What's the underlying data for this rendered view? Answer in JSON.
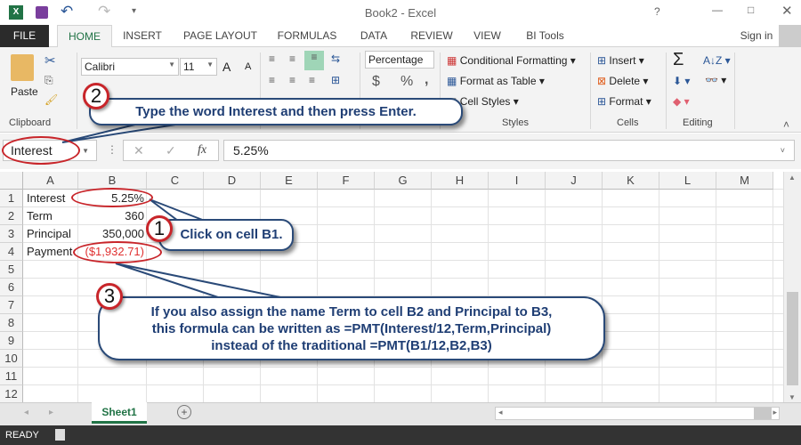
{
  "title": "Book2 - Excel",
  "qat": {
    "excel": "excel-logo",
    "save": "save-icon",
    "undo": "undo-icon",
    "redo": "redo-icon"
  },
  "tabs": [
    "FILE",
    "HOME",
    "INSERT",
    "PAGE LAYOUT",
    "FORMULAS",
    "DATA",
    "REVIEW",
    "VIEW",
    "BI Tools"
  ],
  "active_tab": "HOME",
  "sign_in": "Sign in",
  "ribbon": {
    "paste": "Paste",
    "clipboard": "Clipboard",
    "font": "Calibri",
    "size": "11",
    "number_format": "Percentage",
    "dollar": "$",
    "percent": "%",
    "comma": ",",
    "conditional": "Conditional Formatting",
    "format_table": "Format as Table",
    "cell_styles": "Cell Styles",
    "styles": "Styles",
    "insert": "Insert",
    "delete": "Delete",
    "format": "Format",
    "cells": "Cells",
    "sigma": "Σ",
    "editing": "Editing"
  },
  "formula_bar": {
    "name_box": "Interest",
    "fx": "fx",
    "value": "5.25%"
  },
  "columns": [
    "A",
    "B",
    "C",
    "D",
    "E",
    "F",
    "G",
    "H",
    "I",
    "J",
    "K",
    "L",
    "M"
  ],
  "rows": [
    "1",
    "2",
    "3",
    "4",
    "5",
    "6",
    "7",
    "8",
    "9",
    "10",
    "11",
    "12"
  ],
  "cells": {
    "A1": "Interest",
    "B1": "5.25%",
    "A2": "Term",
    "B2": "360",
    "A3": "Principal",
    "B3": "350,000",
    "A4": "Payment",
    "B4": "($1,932.71)"
  },
  "sheet_tab": "Sheet1",
  "status": "READY",
  "callouts": [
    {
      "num": "1",
      "text": "Click on cell B1."
    },
    {
      "num": "2",
      "text": "Type the word Interest and then press Enter."
    },
    {
      "num": "3",
      "lines": [
        "If you also assign the name Term to cell B2 and Principal to B3,",
        "this formula can be written as =PMT(Interest/12,Term,Principal)",
        "instead of the traditional =PMT(B1/12,B2,B3)"
      ]
    }
  ],
  "colors": {
    "accent": "#217346",
    "negative": "#e03030",
    "callout_text": "#1f3e74",
    "callout_ring": "#c8252a"
  }
}
